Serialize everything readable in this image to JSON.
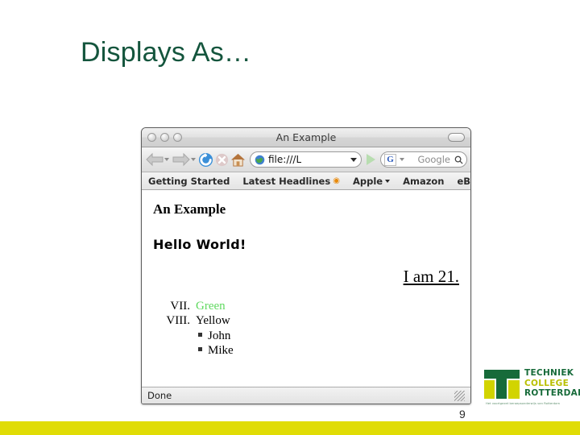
{
  "slide": {
    "title": "Displays As…",
    "title_color": "#14553d",
    "page_number": "9",
    "accent_bar_color": "#e0dc05"
  },
  "browser": {
    "window_title": "An Example",
    "toolbar": {
      "back_icon": "back-arrow-icon",
      "forward_icon": "forward-arrow-icon",
      "reload_icon": "reload-icon",
      "stop_icon": "stop-icon",
      "home_icon": "home-icon",
      "url_value": "file:///L",
      "url_icon": "globe-icon",
      "go_icon": "go-arrow-icon",
      "search_engine": "G",
      "search_placeholder": "Google",
      "search_icon": "magnifier-icon"
    },
    "bookmarks": [
      {
        "label": "Getting Started",
        "icon": "",
        "caret": false
      },
      {
        "label": "Latest Headlines",
        "icon": "rss-icon",
        "caret": false
      },
      {
        "label": "Apple",
        "icon": "",
        "caret": true
      },
      {
        "label": "Amazon",
        "icon": "",
        "caret": false
      },
      {
        "label": "eBay",
        "icon": "",
        "caret": false
      }
    ],
    "bookmarks_overflow": "»",
    "content": {
      "heading": "An Example",
      "hello": "Hello World!",
      "age_line": "I am 21.",
      "roman_list": [
        {
          "num": "VII.",
          "text": "Green",
          "color": "#5fd95f"
        },
        {
          "num": "VIII.",
          "text": "Yellow",
          "color": "#000000"
        }
      ],
      "sub_list": [
        "John",
        "Mike"
      ]
    },
    "status_text": "Done"
  },
  "logo": {
    "line1": "TECHNIEK",
    "line2": "COLLEGE",
    "line3": "ROTTERDAM",
    "tagline": "Het voortgezet beroepsonderwijs van Rotterdam",
    "green": "#176b3a",
    "yellow": "#d2d400"
  }
}
